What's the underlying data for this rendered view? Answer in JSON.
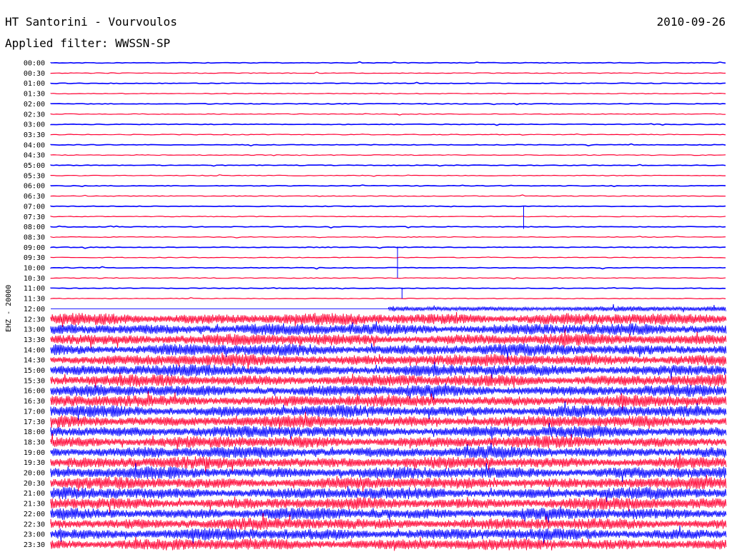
{
  "header": {
    "station": "HT Santorini - Vourvoulos",
    "date": "2010-09-26",
    "filter": "Applied filter: WWSSN-SP"
  },
  "channel_label": "EHZ - 20000",
  "colors": {
    "trace_even": "#0000ff",
    "trace_odd": "#ff0033",
    "background": "#ffffff",
    "text": "#000000"
  },
  "chart_data": {
    "type": "line",
    "plot_kind": "helicorder seismogram",
    "x_units": "minutes within each 30-minute row",
    "xlim": [
      0,
      30
    ],
    "row_labels": [
      "00:00",
      "00:30",
      "01:00",
      "01:30",
      "02:00",
      "02:30",
      "03:00",
      "03:30",
      "04:00",
      "04:30",
      "05:00",
      "05:30",
      "06:00",
      "06:30",
      "07:00",
      "07:30",
      "08:00",
      "08:30",
      "09:00",
      "09:30",
      "10:00",
      "10:30",
      "11:00",
      "11:30",
      "12:00",
      "12:30",
      "13:00",
      "13:30",
      "14:00",
      "14:30",
      "15:00",
      "15:30",
      "16:00",
      "16:30",
      "17:00",
      "17:30",
      "18:00",
      "18:30",
      "19:00",
      "19:30",
      "20:00",
      "20:30",
      "21:00",
      "21:30",
      "22:00",
      "22:30",
      "23:00",
      "23:30"
    ],
    "row_colors": [
      "blue",
      "red"
    ],
    "activity_level": [
      0.02,
      0.02,
      0.02,
      0.02,
      0.02,
      0.02,
      0.02,
      0.02,
      0.03,
      0.02,
      0.03,
      0.02,
      0.02,
      0.02,
      0.03,
      0.02,
      0.02,
      0.02,
      0.03,
      0.02,
      0.02,
      0.02,
      0.02,
      0.03,
      0.35,
      1,
      1,
      1,
      1,
      1,
      1,
      1,
      1,
      1,
      1,
      1,
      1,
      1,
      1,
      1,
      1,
      1,
      1,
      1,
      1,
      1,
      1,
      1
    ],
    "events": [
      {
        "row": "07:00",
        "minute": 21.0,
        "rows_spanned": 2.2,
        "polarity": "down"
      },
      {
        "row": "09:00",
        "minute": 15.4,
        "rows_spanned": 3.0,
        "polarity": "down"
      },
      {
        "row": "11:00",
        "minute": 15.6,
        "rows_spanned": 1.0,
        "polarity": "down"
      }
    ],
    "noise_onset": {
      "row": "12:00",
      "minute": 15.0
    }
  }
}
